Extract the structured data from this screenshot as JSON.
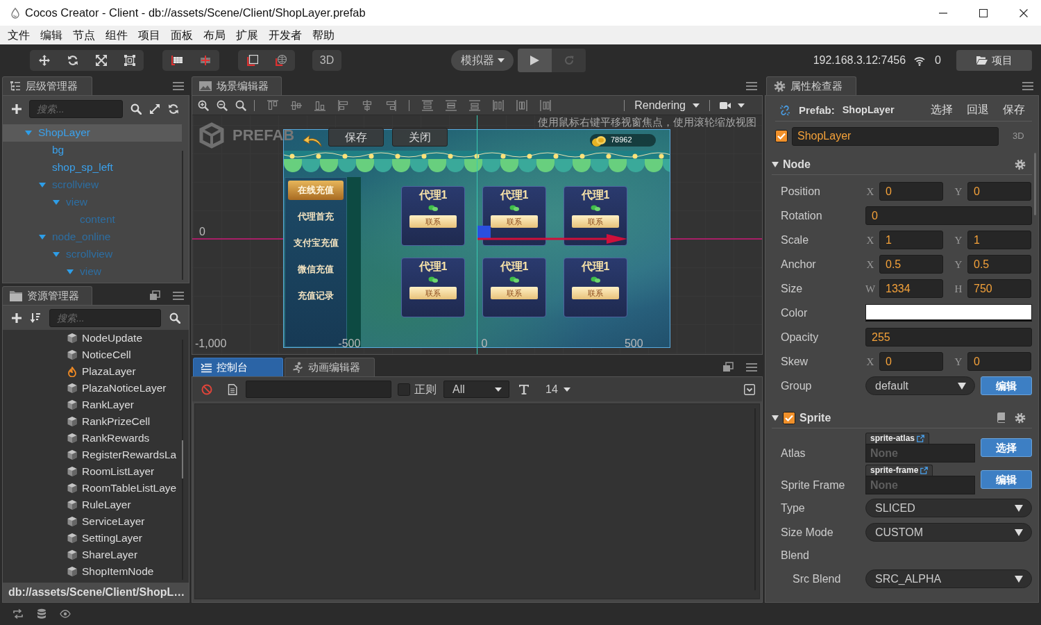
{
  "window": {
    "title": "Cocos Creator - Client - db://assets/Scene/Client/ShopLayer.prefab"
  },
  "menu": [
    "文件",
    "编辑",
    "节点",
    "组件",
    "项目",
    "面板",
    "布局",
    "扩展",
    "开发者",
    "帮助"
  ],
  "toolbar": {
    "mode_button": "3D",
    "simulator": "模拟器",
    "run_buttons": [
      {
        "kind": "play",
        "disabled": false
      },
      {
        "kind": "reload",
        "disabled": true
      }
    ],
    "address": "192.168.3.12:7456",
    "connections": "0",
    "project_button": "项目"
  },
  "hierarchy": {
    "title": "层级管理器",
    "search": {
      "placeholder": "搜索..."
    },
    "tree": [
      {
        "label": "ShopLayer",
        "active": true,
        "selected": true,
        "expanded": true,
        "children": [
          {
            "label": "bg",
            "active": true,
            "selected": false
          },
          {
            "label": "shop_sp_left",
            "active": true,
            "selected": false
          },
          {
            "label": "scrollview",
            "active": false,
            "selected": false,
            "expanded": true,
            "children": [
              {
                "label": "view",
                "active": false,
                "selected": false,
                "expanded": true,
                "children": [
                  {
                    "label": "content",
                    "active": false,
                    "selected": false
                  }
                ]
              }
            ]
          },
          {
            "label": "node_online",
            "active": false,
            "selected": false,
            "expanded": true,
            "children": [
              {
                "label": "scrollview",
                "active": false,
                "selected": false,
                "expanded": true,
                "children": [
                  {
                    "label": "view",
                    "active": false,
                    "selected": false,
                    "expanded": true
                  }
                ]
              }
            ]
          }
        ]
      }
    ]
  },
  "assets": {
    "title": "资源管理器",
    "search": {
      "placeholder": "搜索..."
    },
    "items": [
      {
        "label": "NodeUpdate",
        "kind": "prefab"
      },
      {
        "label": "NoticeCell",
        "kind": "prefab"
      },
      {
        "label": "PlazaLayer",
        "kind": "scene"
      },
      {
        "label": "PlazaNoticeLayer",
        "kind": "prefab"
      },
      {
        "label": "RankLayer",
        "kind": "prefab"
      },
      {
        "label": "RankPrizeCell",
        "kind": "prefab"
      },
      {
        "label": "RankRewards",
        "kind": "prefab"
      },
      {
        "label": "RegisterRewardsLa",
        "kind": "prefab"
      },
      {
        "label": "RoomListLayer",
        "kind": "prefab"
      },
      {
        "label": "RoomTableListLaye",
        "kind": "prefab"
      },
      {
        "label": "RuleLayer",
        "kind": "prefab"
      },
      {
        "label": "ServiceLayer",
        "kind": "prefab"
      },
      {
        "label": "SettingLayer",
        "kind": "prefab"
      },
      {
        "label": "ShareLayer",
        "kind": "prefab"
      },
      {
        "label": "ShopItemNode",
        "kind": "prefab"
      }
    ],
    "path": "db://assets/Scene/Client/ShopL…"
  },
  "scene": {
    "title": "场景编辑器",
    "rendering": "Rendering",
    "badge": "PREFAB",
    "actions": [
      "保存",
      "关闭"
    ],
    "hint": "使用鼠标右键平移视窗焦点，使用滚轮缩放视图",
    "y_labels": [
      "0"
    ],
    "x_labels": [
      "-1,000",
      "-500",
      "0",
      "500"
    ],
    "game": {
      "coins": "78962",
      "menu": [
        {
          "label": "在线充值",
          "selected": true
        },
        {
          "label": "代理首充",
          "selected": false
        },
        {
          "label": "支付宝充值",
          "selected": false
        },
        {
          "label": "微信充值",
          "selected": false
        },
        {
          "label": "充值记录",
          "selected": false
        }
      ],
      "cards": [
        {
          "title": "代理1",
          "button": "联系"
        },
        {
          "title": "代理1",
          "button": "联系"
        },
        {
          "title": "代理1",
          "button": "联系"
        },
        {
          "title": "代理1",
          "button": "联系"
        },
        {
          "title": "代理1",
          "button": "联系"
        },
        {
          "title": "代理1",
          "button": "联系"
        }
      ]
    }
  },
  "console": {
    "tabs": [
      {
        "label": "控制台",
        "kind": "console",
        "selected": true
      },
      {
        "label": "动画编辑器",
        "kind": "animation",
        "selected": false
      }
    ],
    "regex": {
      "label": "正则",
      "checked": false
    },
    "level": "All",
    "font_size": "14"
  },
  "inspector": {
    "title": "属性检查器",
    "prefab": {
      "label": "Prefab:",
      "name": "ShopLayer",
      "actions": [
        "选择",
        "回退",
        "保存"
      ]
    },
    "node": {
      "active": true,
      "name": "ShopLayer",
      "badge": "3D"
    },
    "sections": [
      {
        "title": "Node",
        "kind": "node",
        "expanded": true,
        "props": [
          {
            "kind": "vec2",
            "label": "Position",
            "fields": [
              {
                "axis": "X",
                "value": "0"
              },
              {
                "axis": "Y",
                "value": "0"
              }
            ]
          },
          {
            "kind": "number",
            "label": "Rotation",
            "value": "0"
          },
          {
            "kind": "vec2",
            "label": "Scale",
            "fields": [
              {
                "axis": "X",
                "value": "1"
              },
              {
                "axis": "Y",
                "value": "1"
              }
            ]
          },
          {
            "kind": "vec2",
            "label": "Anchor",
            "fields": [
              {
                "axis": "X",
                "value": "0.5"
              },
              {
                "axis": "Y",
                "value": "0.5"
              }
            ]
          },
          {
            "kind": "vec2",
            "label": "Size",
            "fields": [
              {
                "axis": "W",
                "value": "1334"
              },
              {
                "axis": "H",
                "value": "750"
              }
            ]
          },
          {
            "kind": "color",
            "label": "Color",
            "color": "#ffffff"
          },
          {
            "kind": "number",
            "label": "Opacity",
            "value": "255"
          },
          {
            "kind": "vec2",
            "label": "Skew",
            "fields": [
              {
                "axis": "X",
                "value": "0"
              },
              {
                "axis": "Y",
                "value": "0"
              }
            ]
          },
          {
            "kind": "select",
            "label": "Group",
            "value": "default",
            "button": "编辑"
          }
        ]
      },
      {
        "title": "Sprite",
        "kind": "component",
        "expanded": true,
        "enabled": true,
        "props": [
          {
            "kind": "asset",
            "label": "Atlas",
            "tag": "sprite-atlas",
            "placeholder": "None",
            "button": "选择"
          },
          {
            "kind": "asset",
            "label": "Sprite Frame",
            "tag": "sprite-frame",
            "placeholder": "None",
            "button": "编辑"
          },
          {
            "kind": "select",
            "label": "Type",
            "value": "SLICED"
          },
          {
            "kind": "select",
            "label": "Size Mode",
            "value": "CUSTOM"
          },
          {
            "kind": "group",
            "label": "Blend",
            "children": [
              {
                "kind": "select",
                "label": "Src Blend",
                "value": "SRC_ALPHA"
              }
            ]
          }
        ]
      }
    ]
  }
}
